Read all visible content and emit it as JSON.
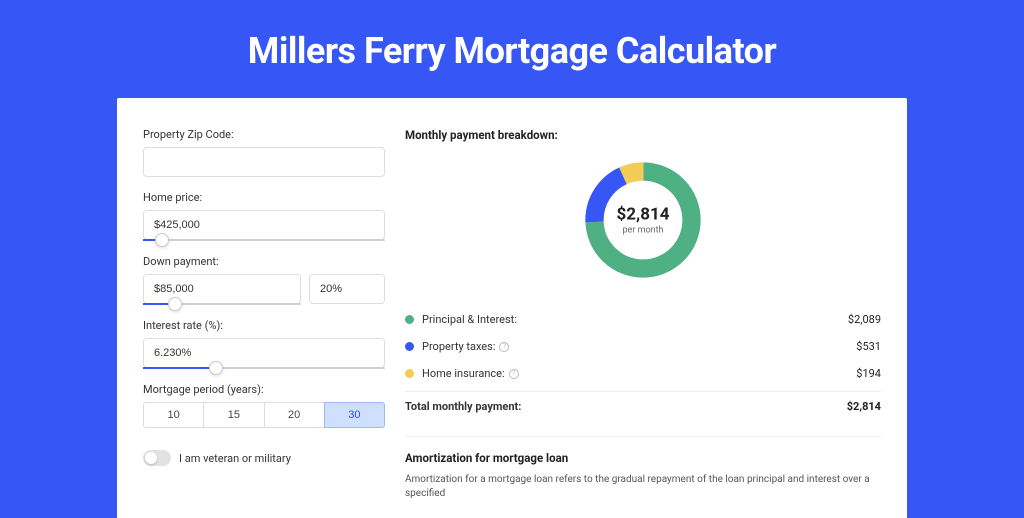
{
  "page_title": "Millers Ferry Mortgage Calculator",
  "form": {
    "zip": {
      "label": "Property Zip Code:",
      "value": ""
    },
    "home_price": {
      "label": "Home price:",
      "value": "$425,000",
      "slider_pct": 8
    },
    "down_payment": {
      "label": "Down payment:",
      "amount": "$85,000",
      "percent": "20%",
      "slider_pct": 20
    },
    "interest_rate": {
      "label": "Interest rate (%):",
      "value": "6.230%",
      "slider_pct": 30
    },
    "period": {
      "label": "Mortgage period (years):",
      "options": [
        "10",
        "15",
        "20",
        "30"
      ],
      "selected": "30"
    },
    "veteran": {
      "label": "I am veteran or military",
      "checked": false
    }
  },
  "breakdown": {
    "header": "Monthly payment breakdown:",
    "donut": {
      "center_value": "$2,814",
      "center_sub": "per month"
    },
    "items": [
      {
        "label": "Principal & Interest:",
        "amount": "$2,089",
        "color": "#4fb084",
        "info": false
      },
      {
        "label": "Property taxes:",
        "amount": "$531",
        "color": "#3656f5",
        "info": true
      },
      {
        "label": "Home insurance:",
        "amount": "$194",
        "color": "#f3cc55",
        "info": true
      }
    ],
    "total": {
      "label": "Total monthly payment:",
      "amount": "$2,814"
    }
  },
  "amortization": {
    "title": "Amortization for mortgage loan",
    "text": "Amortization for a mortgage loan refers to the gradual repayment of the loan principal and interest over a specified"
  },
  "chart_data": {
    "type": "pie",
    "title": "Monthly payment breakdown",
    "series": [
      {
        "name": "Principal & Interest",
        "value": 2089,
        "color": "#4fb084"
      },
      {
        "name": "Property taxes",
        "value": 531,
        "color": "#3656f5"
      },
      {
        "name": "Home insurance",
        "value": 194,
        "color": "#f3cc55"
      }
    ],
    "total": 2814,
    "center_label": "$2,814 per month"
  }
}
